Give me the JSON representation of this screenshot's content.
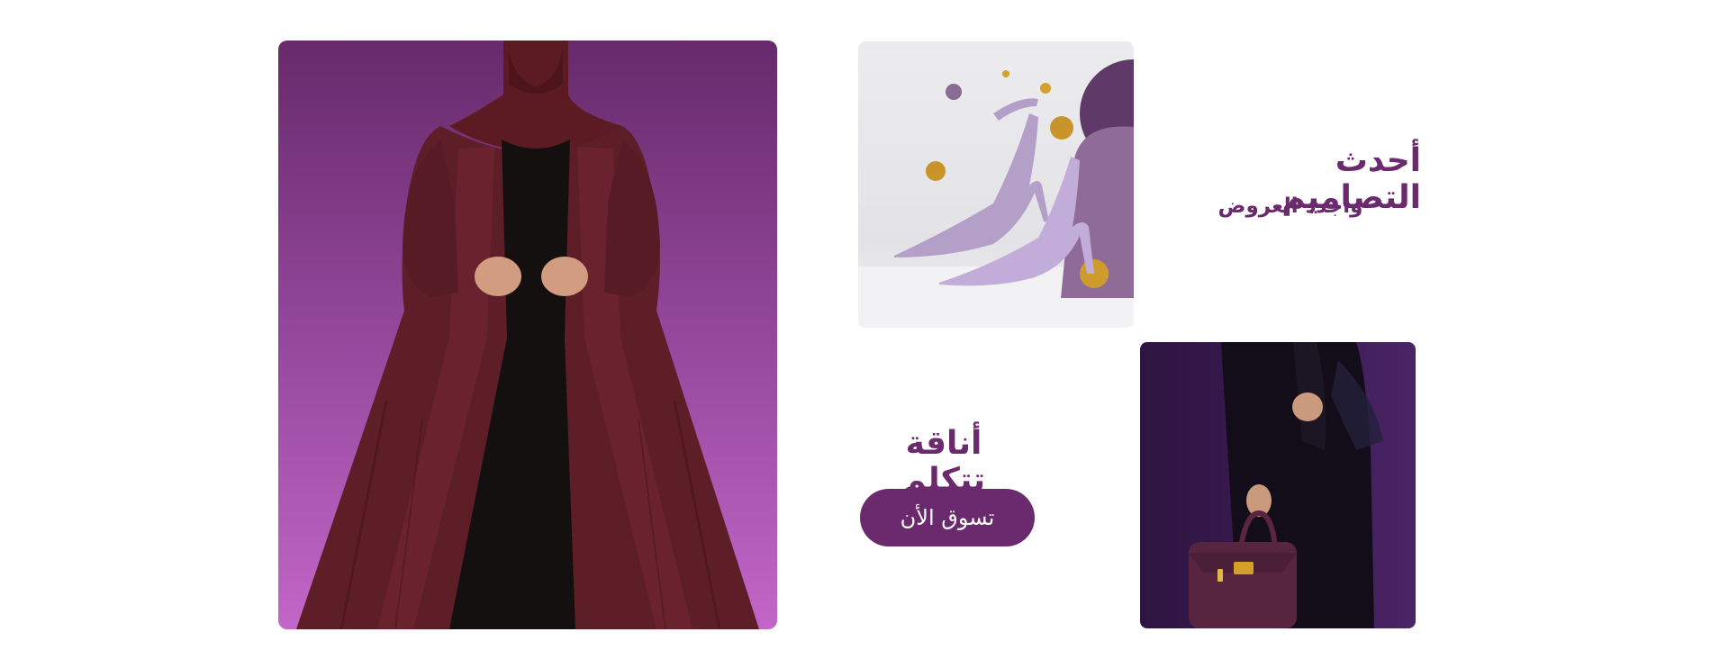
{
  "hero_image": {
    "alt": "abaya-model-image"
  },
  "shoes_image": {
    "alt": "lilac-heels-image"
  },
  "bag_image": {
    "alt": "abaya-handbag-image"
  },
  "promo": {
    "title": "أحدث التصاميم",
    "subtitle": "وأجدد العروض"
  },
  "cta": {
    "title": "أناقة تتكلم",
    "button_label": "تسوق الأن"
  },
  "colors": {
    "brand": "#6a2a6d",
    "button": "#6c2a6e",
    "hero_top": "#672a6b",
    "hero_bottom": "#c266c8"
  }
}
